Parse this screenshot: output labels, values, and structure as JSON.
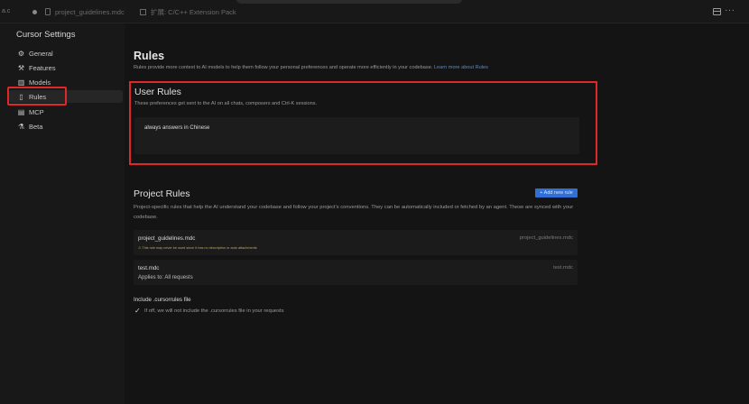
{
  "tabbar": {
    "left_fragment": "a.c",
    "tabs": [
      {
        "label": "project_guidelines.mdc"
      },
      {
        "label": "扩展: C/C++ Extension Pack"
      }
    ]
  },
  "sidebar": {
    "title": "Cursor Settings",
    "items": [
      {
        "label": "General",
        "icon": "gear-icon"
      },
      {
        "label": "Features",
        "icon": "tools-icon"
      },
      {
        "label": "Models",
        "icon": "chart-icon"
      },
      {
        "label": "Rules",
        "icon": "document-icon",
        "active": true
      },
      {
        "label": "MCP",
        "icon": "server-icon"
      },
      {
        "label": "Beta",
        "icon": "flask-icon"
      }
    ]
  },
  "main": {
    "title": "Rules",
    "description": "Rules provide more context to AI models to help them follow your personal preferences and operate more efficiently in your codebase.",
    "learn_more": "Learn more about Rules",
    "user_rules": {
      "title": "User Rules",
      "description": "These preferences get sent to the AI on all chats, composers and Ctrl-K sessions.",
      "value": "always answers in Chinese"
    },
    "project_rules": {
      "title": "Project Rules",
      "add_button": "+ Add new rule",
      "description": "Project-specific rules that help the AI understand your codebase and follow your project's conventions. They can be automatically included or fetched by an agent. These are synced with your codebase.",
      "rules": [
        {
          "name": "project_guidelines.mdc",
          "path": "project_guidelines.mdc",
          "note": "⚠ This rule may never be used since it has no description or auto attachments"
        },
        {
          "name": "test.mdc",
          "path": "test.mdc",
          "note": "Applies to: All requests"
        }
      ]
    },
    "cursorrules": {
      "title": "Include .cursorrules file",
      "description": "If off, we will not include the .cursorrules file in your requests",
      "checked": true
    }
  },
  "colors": {
    "highlight": "#e02828",
    "accent": "#2f6fd6",
    "link": "#4d8fd6"
  }
}
